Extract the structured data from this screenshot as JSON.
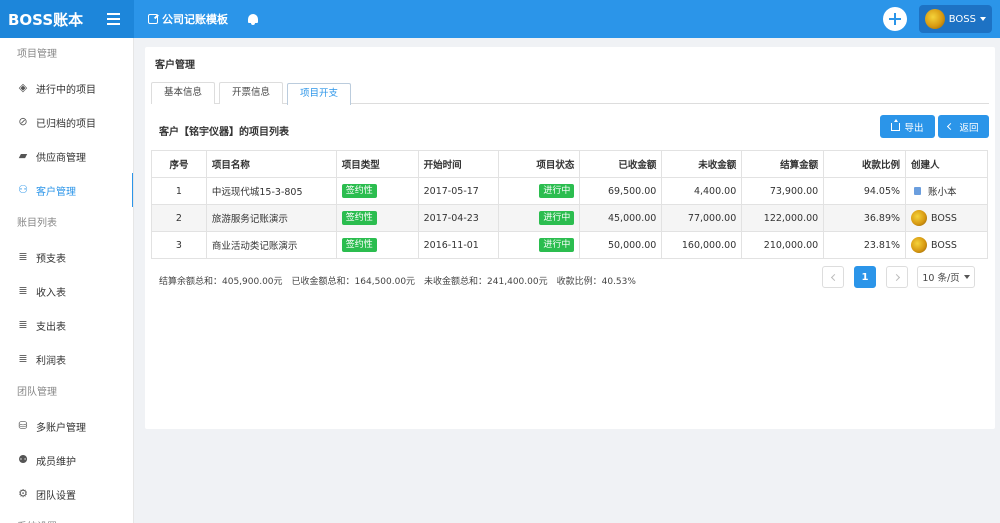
{
  "brand": {
    "name": "BOSS账本"
  },
  "topbar": {
    "template_link": "公司记账模板",
    "user_name": "BOSS"
  },
  "sidebar": {
    "groups": [
      {
        "title": "项目管理",
        "items": [
          {
            "label": "进行中的项目",
            "icon": "layers-icon"
          },
          {
            "label": "已归档的项目",
            "icon": "check-circle-icon"
          },
          {
            "label": "供应商管理",
            "icon": "truck-icon"
          },
          {
            "label": "客户管理",
            "icon": "users-icon",
            "active": true
          }
        ]
      },
      {
        "title": "账目列表",
        "items": [
          {
            "label": "预支表",
            "icon": "database-icon"
          },
          {
            "label": "收入表",
            "icon": "database-icon"
          },
          {
            "label": "支出表",
            "icon": "database-icon"
          },
          {
            "label": "利润表",
            "icon": "database-icon"
          }
        ]
      },
      {
        "title": "团队管理",
        "items": [
          {
            "label": "多账户管理",
            "icon": "coins-icon"
          },
          {
            "label": "成员维护",
            "icon": "user-group-icon"
          },
          {
            "label": "团队设置",
            "icon": "settings-icon"
          }
        ]
      },
      {
        "title": "系统设置",
        "items": []
      }
    ]
  },
  "main": {
    "card_title": "客户管理",
    "tabs": [
      {
        "label": "基本信息",
        "active": false
      },
      {
        "label": "开票信息",
        "active": false
      },
      {
        "label": "项目开支",
        "active": true
      }
    ],
    "list_title": "客户【铭宇仪器】的项目列表",
    "export_label": "导出",
    "back_label": "返回",
    "table": {
      "headers": [
        "序号",
        "项目名称",
        "项目类型",
        "开始时间",
        "项目状态",
        "已收金额",
        "未收金额",
        "结算金额",
        "收款比例",
        "创建人"
      ],
      "rows": [
        {
          "no": "1",
          "name": "中远现代城15-3-805",
          "type": "签约性",
          "start": "2017-05-17",
          "status": "进行中",
          "received": "69,500.00",
          "unreceived": "4,400.00",
          "settled": "73,900.00",
          "ratio": "94.05%",
          "creator": "账小本",
          "creator_icon": "doc-icon"
        },
        {
          "no": "2",
          "name": "旅游服务记账演示",
          "type": "签约性",
          "start": "2017-04-23",
          "status": "进行中",
          "received": "45,000.00",
          "unreceived": "77,000.00",
          "settled": "122,000.00",
          "ratio": "36.89%",
          "creator": "BOSS",
          "creator_icon": "avatar-icon"
        },
        {
          "no": "3",
          "name": "商业活动类记账演示",
          "type": "签约性",
          "start": "2016-11-01",
          "status": "进行中",
          "received": "50,000.00",
          "unreceived": "160,000.00",
          "settled": "210,000.00",
          "ratio": "23.81%",
          "creator": "BOSS",
          "creator_icon": "avatar-icon"
        }
      ]
    },
    "summary": "结算余额总和：405,900.00元　已收金额总和：164,500.00元　未收金额总和：241,400.00元　收款比例：40.53%",
    "pagination": {
      "current_page": "1",
      "page_size_label": "10 条/页"
    }
  },
  "colors": {
    "primary": "#2b95e9",
    "tag_green": "#2bbd4f"
  }
}
